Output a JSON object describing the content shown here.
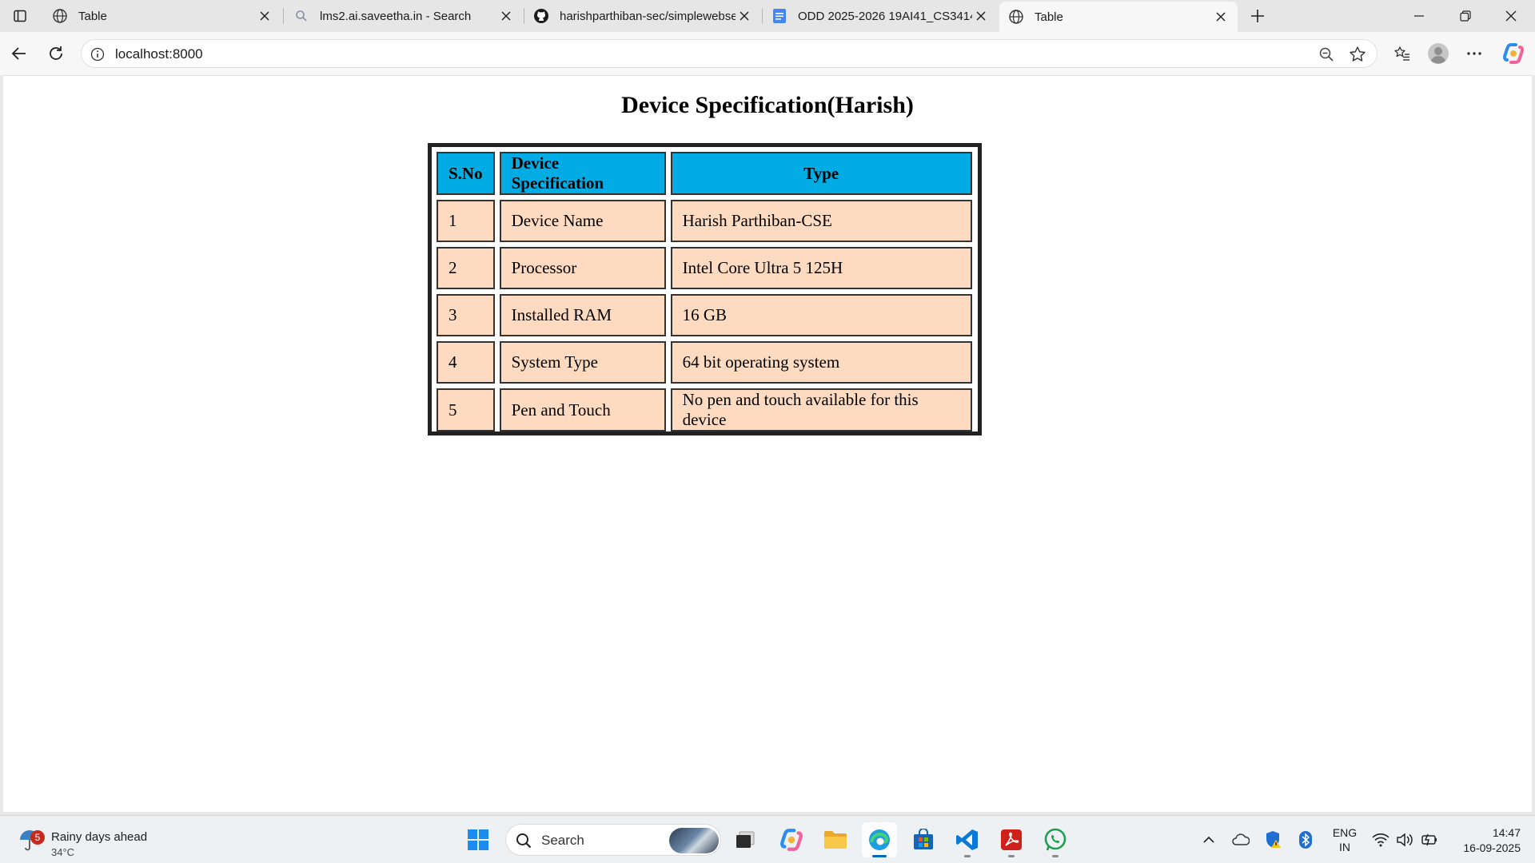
{
  "browser": {
    "tabs": [
      {
        "title": "Table",
        "favicon": "globe-icon",
        "active": false
      },
      {
        "title": "lms2.ai.saveetha.in - Search",
        "favicon": "search-icon",
        "active": false
      },
      {
        "title": "harishparthiban-sec/simplewebse",
        "favicon": "github-icon",
        "active": false
      },
      {
        "title": "ODD 2025-2026 19AI41_CS3414-",
        "favicon": "docs-icon",
        "active": false
      },
      {
        "title": "Table",
        "favicon": "globe-icon",
        "active": true
      }
    ],
    "address": "localhost:8000"
  },
  "page": {
    "title": "Device Specification(Harish)",
    "table": {
      "headers": [
        "S.No",
        "Device Specification",
        "Type"
      ],
      "rows": [
        [
          "1",
          "Device Name",
          "Harish Parthiban-CSE"
        ],
        [
          "2",
          "Processor",
          "Intel Core Ultra 5 125H"
        ],
        [
          "3",
          "Installed RAM",
          "16 GB"
        ],
        [
          "4",
          "System Type",
          "64 bit operating system"
        ],
        [
          "5",
          "Pen and Touch",
          "No pen and touch available for this device"
        ]
      ]
    },
    "colors": {
      "header_bg": "#00ace3",
      "cell_bg": "#fedbc0",
      "table_border": "#222222"
    }
  },
  "taskbar": {
    "weather": {
      "badge": "5",
      "headline": "Rainy days ahead",
      "temp": "34°C"
    },
    "search_label": "Search",
    "lang_line1": "ENG",
    "lang_line2": "IN",
    "time": "14:47",
    "date": "16-09-2025"
  }
}
